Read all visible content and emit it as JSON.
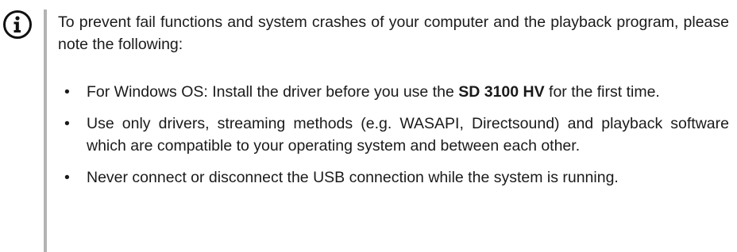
{
  "note": {
    "icon": "info-icon",
    "bar_color": "#b3b3b3",
    "intro": "To prevent fail functions and system crashes of your computer and the playback program, please note the following:",
    "bullet_symbol": "•",
    "items": [
      {
        "before": "For Windows OS: Install the driver before you use the ",
        "bold": "SD 3100 HV",
        "after": " for the first time."
      },
      {
        "text": "Use only drivers, streaming methods (e.g. WASAPI, Directsound) and playback software which are compatible to your operating system and between each other."
      },
      {
        "text": "Never connect or disconnect the USB connection while the system is running."
      }
    ]
  }
}
